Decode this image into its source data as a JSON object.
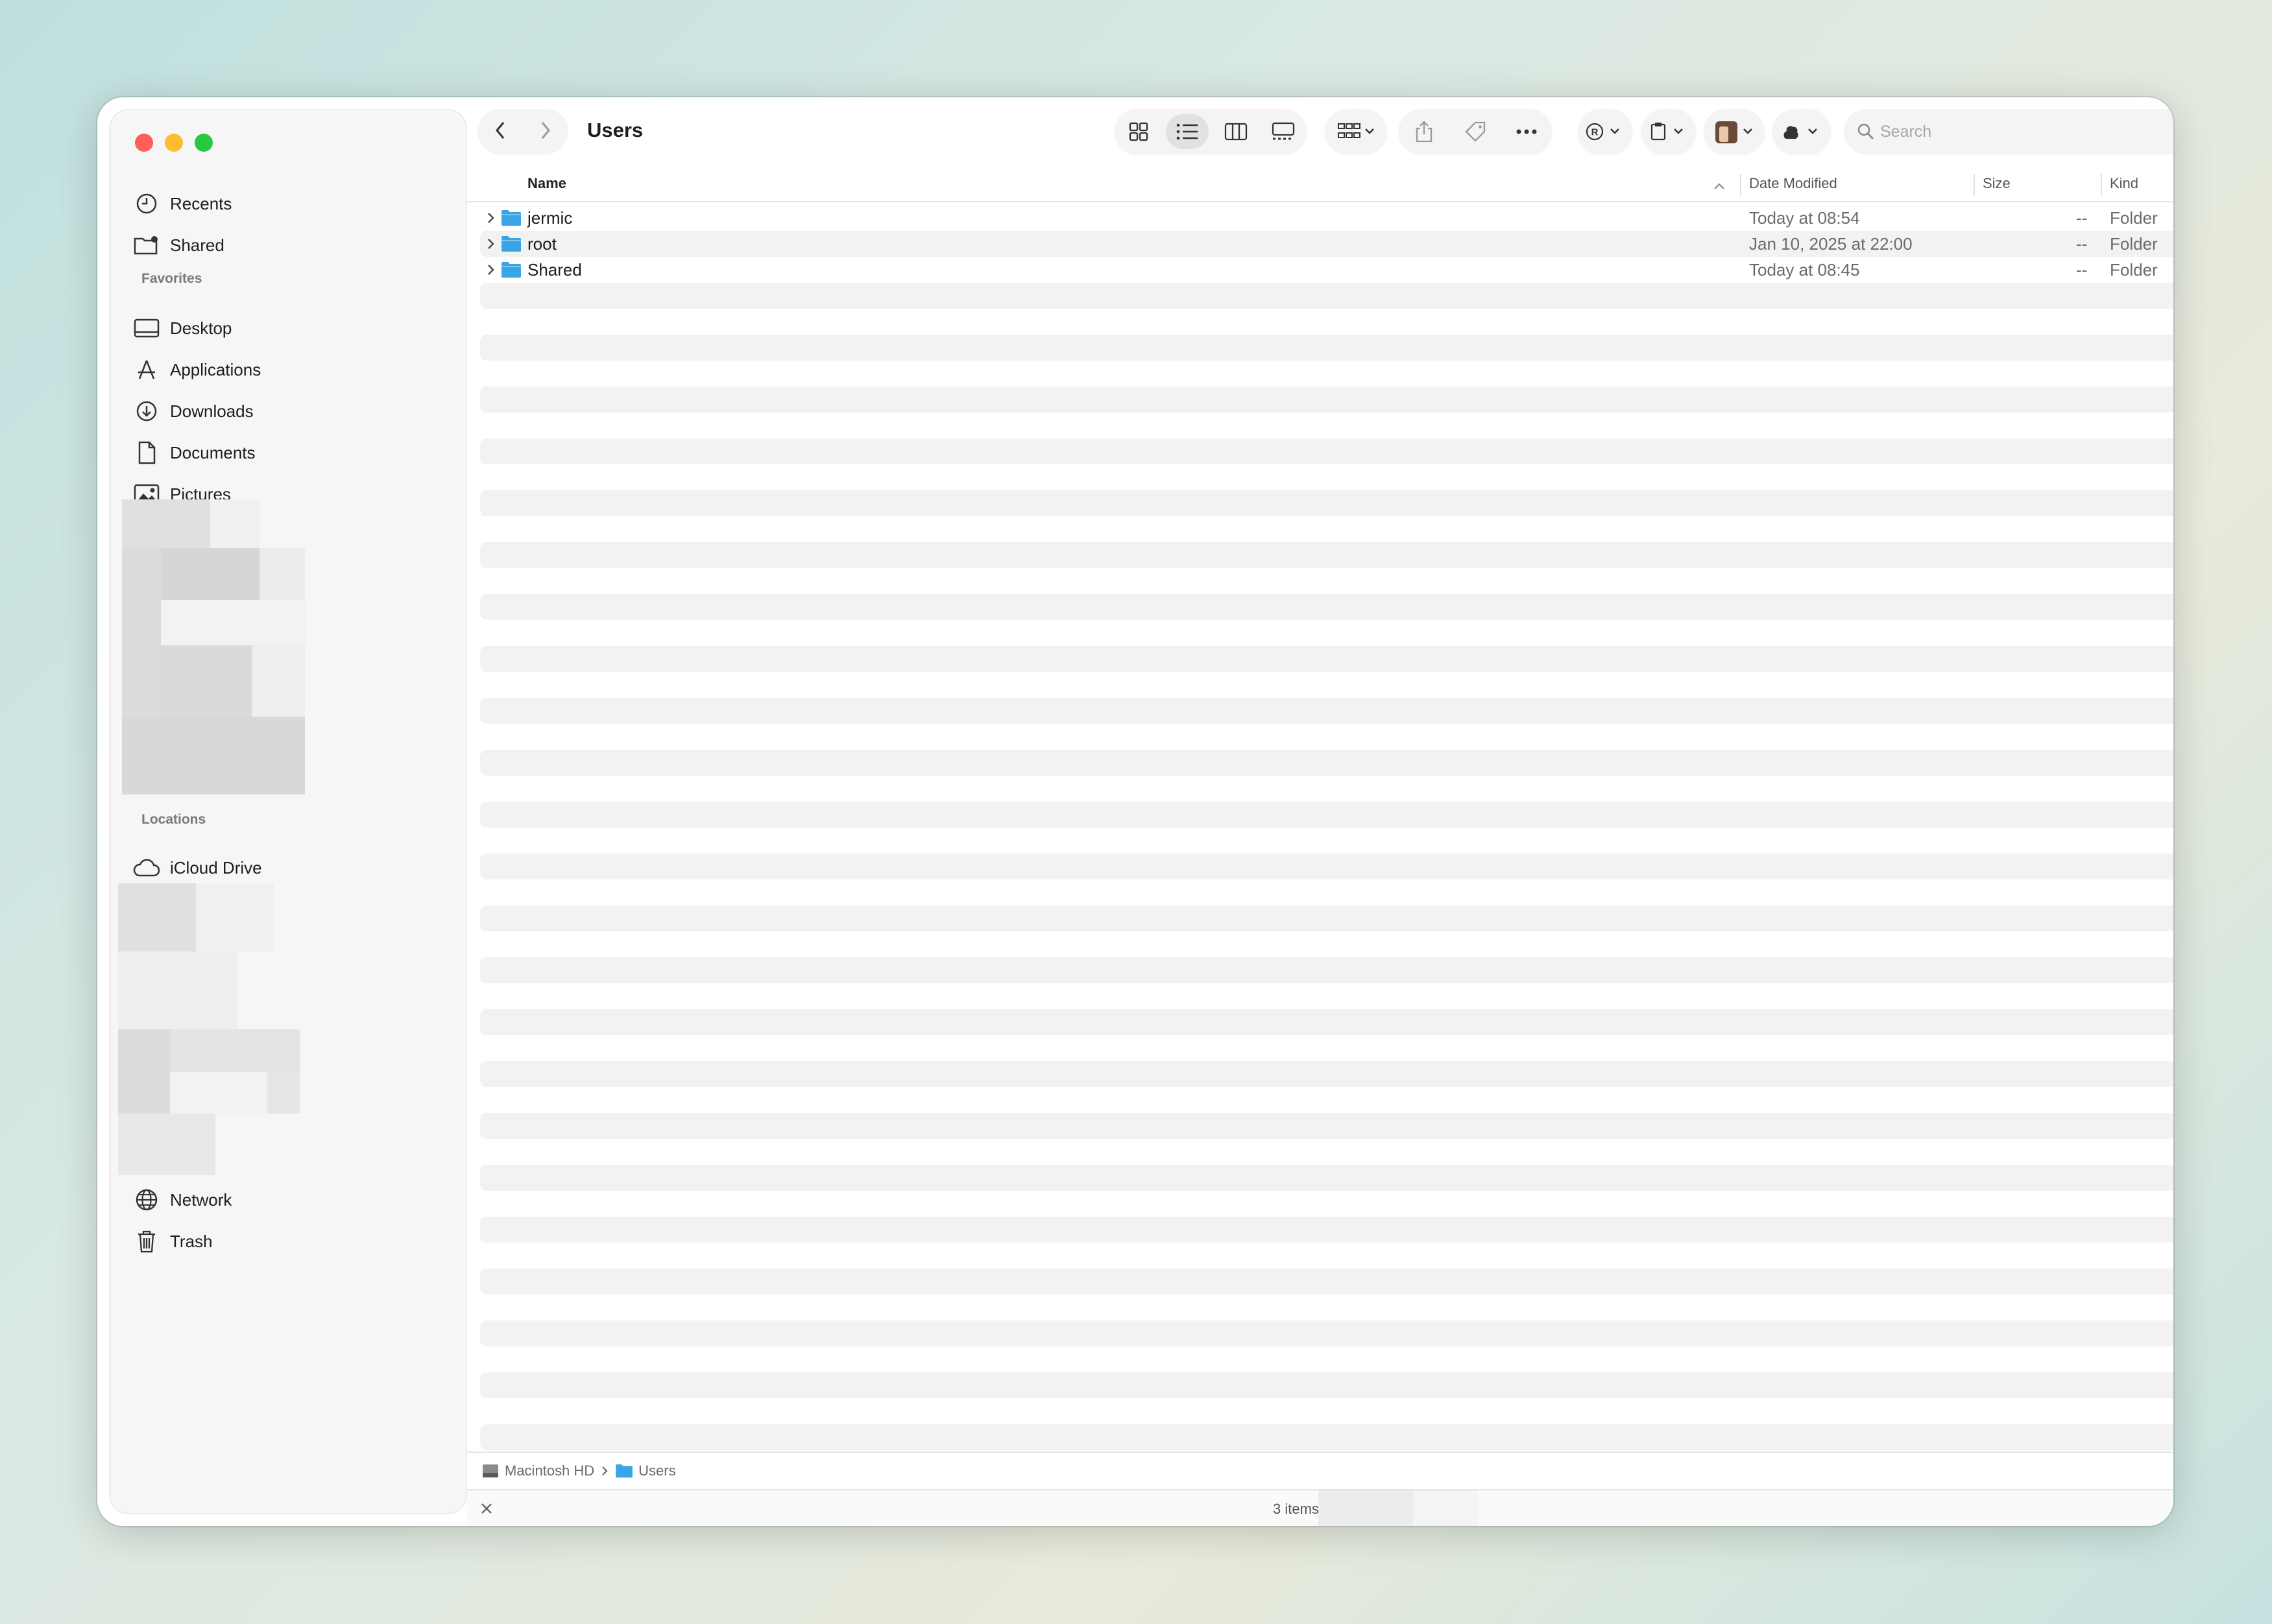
{
  "window": {
    "title": "Users"
  },
  "sidebar": {
    "top_items": [
      {
        "label": "Recents",
        "icon": "clock-icon"
      },
      {
        "label": "Shared",
        "icon": "shared-folder-icon"
      }
    ],
    "favorites_header": "Favorites",
    "favorites": [
      {
        "label": "Desktop",
        "icon": "desktop-icon"
      },
      {
        "label": "Applications",
        "icon": "applications-icon"
      },
      {
        "label": "Downloads",
        "icon": "download-icon"
      },
      {
        "label": "Documents",
        "icon": "document-icon"
      },
      {
        "label": "Pictures",
        "icon": "pictures-icon"
      }
    ],
    "locations_header": "Locations",
    "locations": [
      {
        "label": "iCloud Drive",
        "icon": "cloud-icon"
      }
    ],
    "bottom_items": [
      {
        "label": "Network",
        "icon": "globe-icon"
      },
      {
        "label": "Trash",
        "icon": "trash-icon"
      }
    ]
  },
  "toolbar": {
    "search_placeholder": "Search"
  },
  "columns": {
    "name": "Name",
    "date_modified": "Date Modified",
    "size": "Size",
    "kind": "Kind"
  },
  "files": [
    {
      "name": "jermic",
      "date": "Today at 08:54",
      "size": "--",
      "kind": "Folder"
    },
    {
      "name": "root",
      "date": "Jan 10, 2025 at 22:00",
      "size": "--",
      "kind": "Folder"
    },
    {
      "name": "Shared",
      "date": "Today at 08:45",
      "size": "--",
      "kind": "Folder"
    }
  ],
  "pathbar": {
    "items": [
      "Macintosh HD",
      "Users"
    ]
  },
  "status": {
    "text": "3 items"
  },
  "colors": {
    "folder": "#3aa5e6",
    "close": "#ff5f57",
    "minimize": "#febc2e",
    "zoom": "#28c840"
  }
}
